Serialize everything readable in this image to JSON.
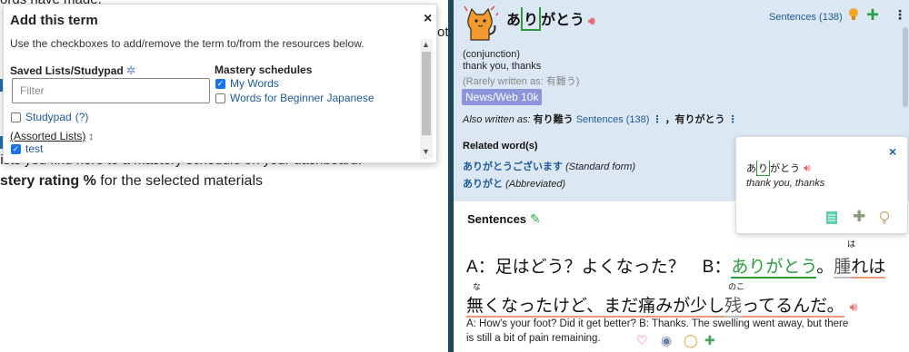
{
  "left": {
    "background_lines": [
      "ords have made.",
      "ot",
      "lists you find here to a mastery schedule on your dashboard.",
      "stery rating %",
      " for the selected materials"
    ]
  },
  "popup": {
    "title": "Add this term",
    "close": "×",
    "description": "Use the checkboxes to add/remove the term to/from the resources below.",
    "saved_lists_heading": "Saved Lists/Studypad",
    "filter_placeholder": "Filter",
    "studypad_label": "Studypad",
    "studypad_hint": "(?)",
    "assorted_label": "(Assorted Lists)",
    "sort_arrows": "↕",
    "test_label": "test",
    "mastery_heading": "Mastery schedules",
    "my_words": "My Words",
    "beginner": "Words for Beginner Japanese"
  },
  "entry": {
    "headword_pre": "あ",
    "headword_box": "り",
    "headword_post": "がとう",
    "sentences_link": "Sentences (138)",
    "pos": "(conjunction)",
    "meaning": "thank you, thanks",
    "rarely": "(Rarely written as: 有難う)",
    "badge": "News/Web 10k",
    "also_label": "Also written as:",
    "also_form1": "有り難う",
    "also_sentences": "Sentences (138)",
    "also_dots": "⋮",
    "also_form2": "，有りがとう",
    "related_heading": "Related word(s)",
    "rel1_word": "ありがとうございます",
    "rel1_note": "(Standard form)",
    "rel2_word": "ありがと",
    "rel2_note": "(Abbreviated)"
  },
  "mini": {
    "close": "×",
    "word_pre": "あ",
    "word_box": "り",
    "word_post": "がとう",
    "meaning": "thank you, thanks"
  },
  "sentences": {
    "heading": "Sentences",
    "line1_a": "A：足はどう？よくなった？　B：",
    "line1_green": "ありがとう",
    "line1_b": "。",
    "line1_c": "腫",
    "line1_d": "れは",
    "furi_ha": "は",
    "line2_a": "無",
    "line2_b": "くなったけど、まだ痛みが少し",
    "line2_c": "残",
    "line2_d": "ってるんだ。",
    "furi_na": "な",
    "furi_noko": "のこ",
    "translation1": "A: How's your foot? Did it get better? B: Thanks. The swelling went away, but there",
    "translation2": "is still a bit of pain remaining."
  },
  "colors": {
    "divider": "#18495b",
    "entry_bg": "#dbe7f3",
    "green": "#2e9a3c",
    "link": "#1f5a96",
    "badge": "#8c95d9"
  }
}
